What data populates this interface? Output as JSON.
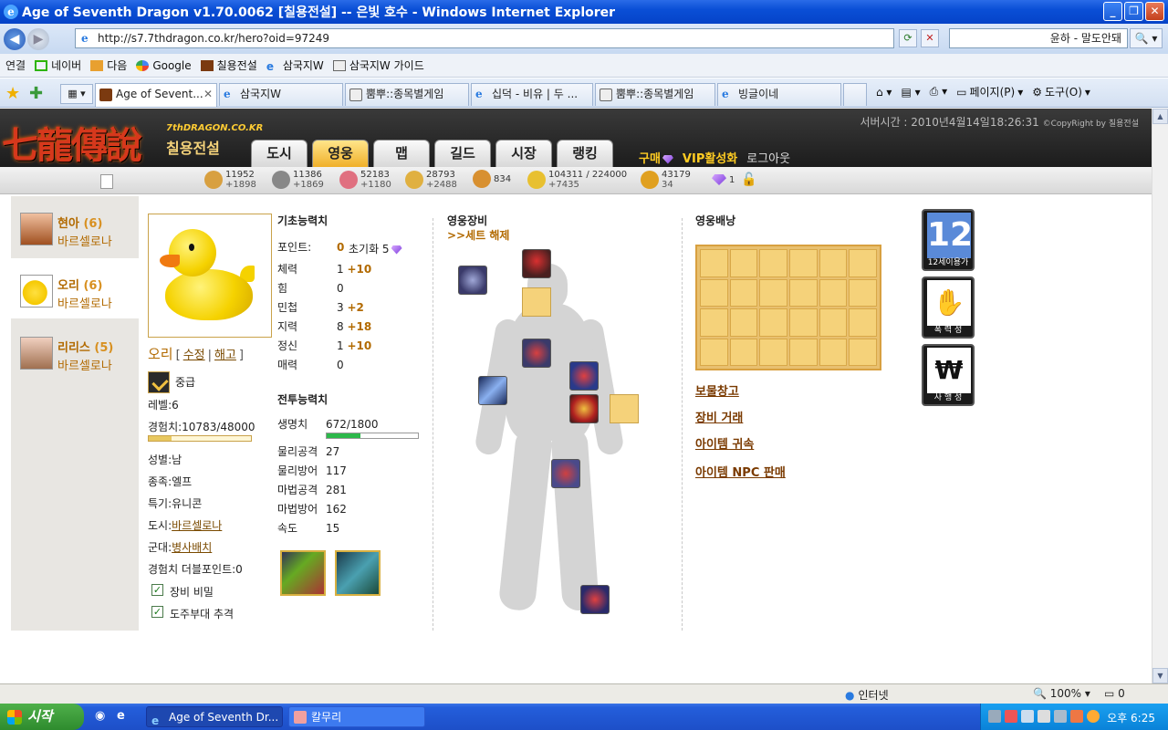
{
  "window": {
    "title": "Age of Seventh Dragon v1.70.0062 [칠용전설] -- 은빛 호수 - Windows Internet Explorer",
    "min_label": "_",
    "max_label": "❐",
    "close_label": "✕"
  },
  "address": {
    "url": "http://s7.7thdragon.co.kr/hero?oid=97249",
    "search_value": "윤하 - 말도안돼",
    "search_btn": "🔍 ▾"
  },
  "links": {
    "label": "연결",
    "items": [
      "네이버",
      "다음",
      "Google",
      "칠용전설",
      "삼국지W",
      "삼국지W 가이드"
    ]
  },
  "tabs": [
    "Age of Sevent...",
    "삼국지W",
    "뿜뿌::종목별게임",
    "십덕 - 비유 | 두 ...",
    "뿜뿌::종목별게임",
    "빙글이네"
  ],
  "commands": {
    "page": "페이지(P)",
    "tools": "도구(O)"
  },
  "game": {
    "logo": "七龍傳說",
    "logo_sub": "7thDRAGON.CO.KR",
    "logo_kr": "칠용전설",
    "server_time": "서버시간 : 2010년4월14일18:26:31",
    "copyright": "©CopyRight by 칠용전설",
    "menu": [
      "도시",
      "영웅",
      "맵",
      "길드",
      "시장",
      "랭킹"
    ],
    "buy": "구매",
    "vip": "VIP활성화",
    "logout": "로그아웃"
  },
  "resources": [
    {
      "icon": "wood-icon",
      "value": "11952",
      "inc": "+1898",
      "color": "#d8a040"
    },
    {
      "icon": "stone-icon",
      "value": "11386",
      "inc": "+1869",
      "color": "#888888"
    },
    {
      "icon": "crystal-icon",
      "value": "52183",
      "inc": "+1180",
      "color": "#e07080"
    },
    {
      "icon": "wheat-icon",
      "value": "28793",
      "inc": "+2488",
      "color": "#e0b040"
    },
    {
      "icon": "food-icon",
      "value": "834",
      "inc": "",
      "color": "#d89030"
    },
    {
      "icon": "population-icon",
      "value": "104311 / 224000",
      "inc": "+7435",
      "color": "#e8c030"
    },
    {
      "icon": "gold-icon",
      "value": "43179",
      "inc": "34",
      "color": "#e0a020"
    },
    {
      "icon": "gem-icon",
      "value": "1",
      "inc": "",
      "color": "#a060e0"
    }
  ],
  "heroes": [
    {
      "name": "현아",
      "level": "(6)",
      "city": "바르셀로나"
    },
    {
      "name": "오리",
      "level": "(6)",
      "city": "바르셀로나"
    },
    {
      "name": "리리스",
      "level": "(5)",
      "city": "바르셀로나"
    }
  ],
  "hero": {
    "name": "오리",
    "edit": "수정",
    "dismiss": "해고",
    "rank": "중급",
    "level": "레벨:6",
    "exp": "경험치:10783/48000",
    "exp_ratio": 0.22,
    "gender": "성별:남",
    "race": "종족:엘프",
    "special": "특기:유니콘",
    "city_label": "도시:",
    "city": "바르셀로나",
    "army_label": "군대:",
    "army": "병사배치",
    "double_exp": "경험치 더블포인트:0",
    "cb1": "장비 비밀",
    "cb2": "도주부대 추격"
  },
  "basic_stats": {
    "title": "기초능력치",
    "points_label": "포인트:",
    "points": "0",
    "reset": "초기화 5",
    "rows": [
      {
        "label": "체력",
        "value": "1",
        "bonus": "+10"
      },
      {
        "label": "힘",
        "value": "0",
        "bonus": ""
      },
      {
        "label": "민첩",
        "value": "3",
        "bonus": "+2"
      },
      {
        "label": "지력",
        "value": "8",
        "bonus": "+18"
      },
      {
        "label": "정신",
        "value": "1",
        "bonus": "+10"
      },
      {
        "label": "매력",
        "value": "0",
        "bonus": ""
      }
    ]
  },
  "combat_stats": {
    "title": "전투능력치",
    "hp_label": "생명치",
    "hp": "672/1800",
    "hp_ratio": 0.373,
    "rows": [
      {
        "label": "물리공격",
        "value": "27"
      },
      {
        "label": "물리방어",
        "value": "117"
      },
      {
        "label": "마법공격",
        "value": "281"
      },
      {
        "label": "마법방어",
        "value": "162"
      },
      {
        "label": "속도",
        "value": "15"
      }
    ]
  },
  "equipment": {
    "title": "영웅장비",
    "set_release": ">>세트 해제"
  },
  "bag": {
    "title": "영웅배낭",
    "links": [
      "보물창고",
      "장비 거래",
      "아이템 귀속",
      "아이템 NPC 판매"
    ]
  },
  "ratings": [
    {
      "icon": "age-12-icon",
      "text": "12",
      "label": "12세이용가"
    },
    {
      "icon": "violence-icon",
      "text": "✋",
      "label": "폭 력 성"
    },
    {
      "icon": "gambling-icon",
      "text": "₩",
      "label": "사 행 성"
    }
  ],
  "status": {
    "zone": "인터넷",
    "zoom": "100%",
    "popup": "0"
  },
  "taskbar": {
    "start": "시작",
    "tasks": [
      "Age of Seventh Dr...",
      "칼무리"
    ],
    "clock": "오후 6:25"
  }
}
